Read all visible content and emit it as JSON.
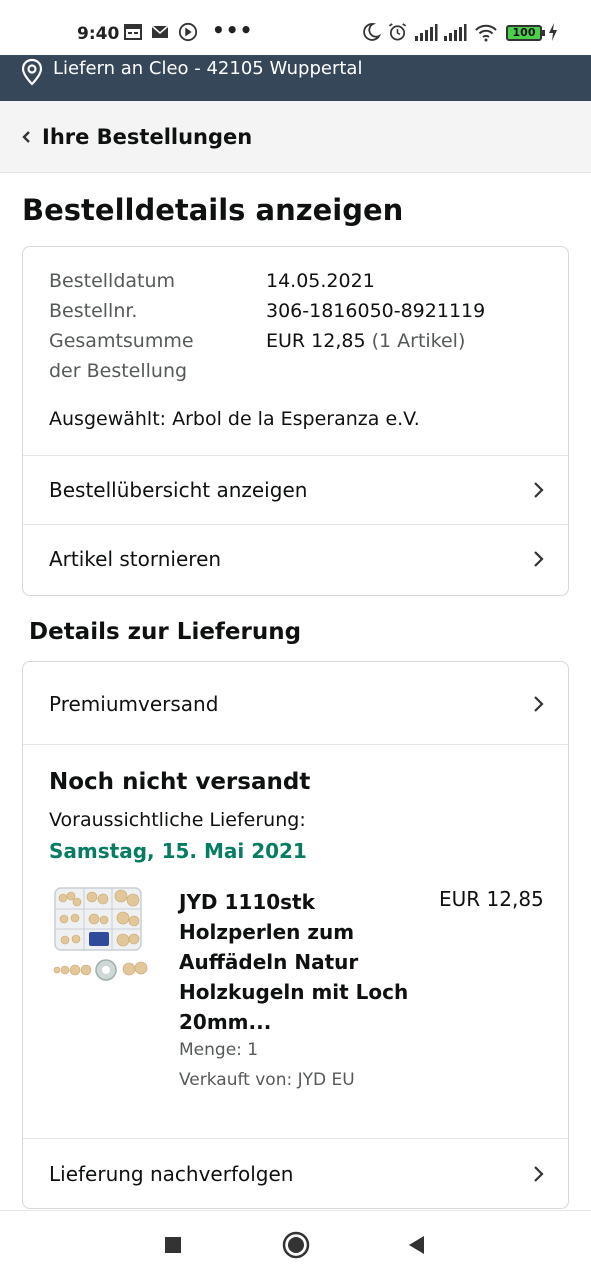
{
  "status_bar": {
    "time": "9:40",
    "dots": "•••",
    "battery": "100",
    "icons": [
      "calendar-icon",
      "mail-icon",
      "vpn-icon",
      "moon-icon",
      "alarm-icon",
      "signal-icon",
      "signal-icon",
      "wifi-icon",
      "battery-icon",
      "charging-icon"
    ]
  },
  "location_bar": {
    "text": "Liefern an Cleo - 42105 Wuppertal",
    "icon": "location-pin-icon"
  },
  "nav": {
    "back_label": "Ihre Bestellungen",
    "icon": "chevron-left-icon"
  },
  "page": {
    "title": "Bestelldetails anzeigen"
  },
  "order": {
    "date_label": "Bestelldatum",
    "date_value": "14.05.2021",
    "number_label": "Bestellnr.",
    "number_value": "306-1816050-8921119",
    "total_label_1": "Gesamtsumme",
    "total_label_2": "der Bestellung",
    "total_value": "EUR 12,85",
    "total_items": "(1 Artikel)",
    "selected": "Ausgewählt: Arbol de la Esperanza e.V.",
    "overview_link": "Bestellübersicht anzeigen",
    "cancel_link": "Artikel stornieren"
  },
  "delivery": {
    "section_title": "Details zur Lieferung",
    "shipping_method": "Premiumversand",
    "status": "Noch nicht versandt",
    "eta_label": "Voraussichtliche Lieferung:",
    "eta_date": "Samstag, 15. Mai 2021",
    "track_link": "Lieferung nachverfolgen"
  },
  "product": {
    "title_lines": [
      "JYD 1110stk",
      "Holzperlen zum",
      "Auffädeln Natur",
      "Holzkugeln mit Loch",
      "20mm..."
    ],
    "price": "EUR 12,85",
    "quantity": "Menge: 1",
    "seller": "Verkauft von: JYD EU"
  },
  "colors": {
    "location_bar_bg": "#37475a",
    "eta_green": "#067d62",
    "muted_text": "#565959",
    "battery_green": "#4cd04c"
  },
  "system_nav": [
    "square-icon",
    "home-circle-icon",
    "back-triangle-icon"
  ]
}
